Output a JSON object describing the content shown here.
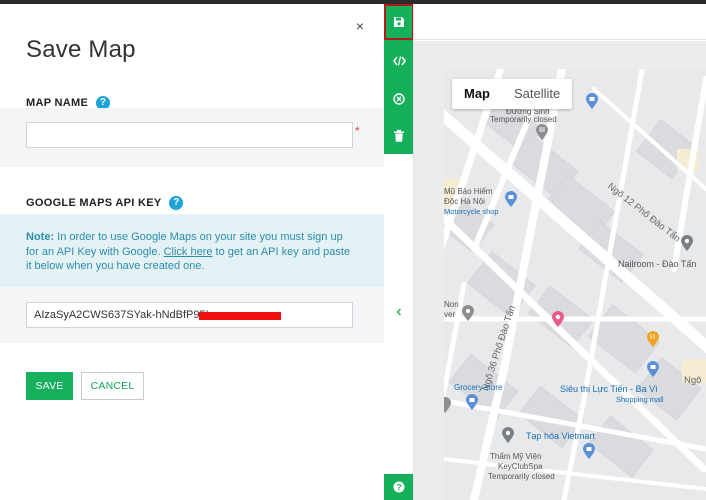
{
  "panel": {
    "title": "Save Map",
    "close_glyph": "×",
    "map_name_label": "MAP NAME",
    "map_name_value": "",
    "map_name_placeholder": "",
    "required_mark": "*",
    "api_key_label": "GOOGLE MAPS API KEY",
    "help_glyph": "?",
    "note_bold": "Note:",
    "note_text_1": " In order to use Google Maps on your site you must sign up for an API Key with Google. ",
    "note_link": "Click here",
    "note_text_2": " to get an API key and paste it below when you have created one.",
    "api_key_value": "AIzaSyA2CWS637SYak-hNdBfP95I",
    "save_label": "SAVE",
    "cancel_label": "CANCEL"
  },
  "toolbar": {
    "items": [
      "save-icon",
      "code-icon",
      "cancel-icon",
      "trash-icon",
      "help-icon"
    ],
    "collapse_glyph": "‹",
    "help_glyph": "?"
  },
  "map": {
    "toggle": {
      "map": "Map",
      "satellite": "Satellite"
    },
    "labels": {
      "duong_sinh": "Đường Sinh",
      "temp_closed_1": "Temporarily closed",
      "bao_hiem_1": "Mũ Bảo Hiểm",
      "bao_hiem_2": "Độc Hà Nội",
      "motorcycle": "Motorcycle shop",
      "ngo12": "Ngõ 12 Phố Đào Tấn",
      "nailroom": "Nailroom - Đào Tấn",
      "non": "Non",
      "ver": "ver",
      "ngo36": "Ngõ 36 Phố Đào Tấn",
      "grocery": "Grocery store",
      "sieu_thi": "Siêu thị Lực Tiến - Ba Vì",
      "shopping": "Shopping mall",
      "ngo": "Ngõ",
      "tap_hoa": "Tạp hóa Vietmart",
      "tham_my_1": "Thẩm Mỹ Viện",
      "tham_my_2": "KeyClubSpa",
      "temp_closed_2": "Temporarily closed"
    }
  },
  "colors": {
    "accent_green": "#17b05a",
    "highlight_red": "#b3191b",
    "note_bg": "#e4f2f5",
    "note_text": "#2b8dab",
    "help_blue": "#1fa2d6"
  }
}
